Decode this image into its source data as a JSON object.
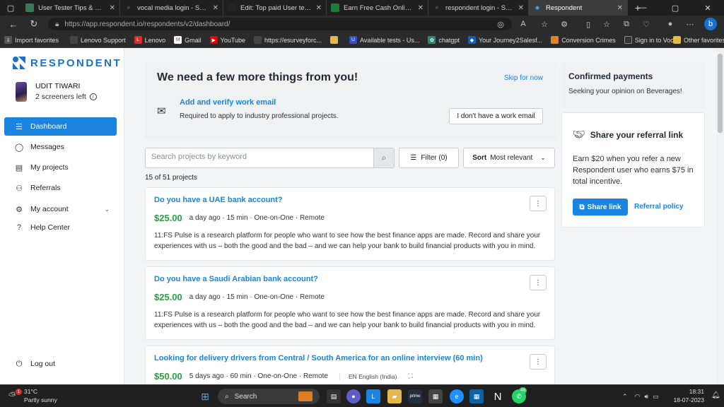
{
  "browser": {
    "tabs": [
      {
        "title": "User Tester Tips & Platform",
        "active": false
      },
      {
        "title": "vocal media login - Search",
        "active": false
      },
      {
        "title": "Edit: Top paid User testing",
        "active": false
      },
      {
        "title": "Earn Free Cash Online | Mak",
        "active": false
      },
      {
        "title": "respondent login - Search",
        "active": false
      },
      {
        "title": "Respondent",
        "active": true
      }
    ],
    "url": "https://app.respondent.io/respondents/v2/dashboard/",
    "bookmarks": [
      "Import favorites",
      "Lenovo Support",
      "Lenovo",
      "Gmail",
      "YouTube",
      "https://esurveyforc...",
      "Available tests - Us...",
      "chatgpt",
      "Your Journey2Salesf...",
      "Conversion Crimes",
      "Sign in to Vocal",
      "Other favorites"
    ]
  },
  "sidebar": {
    "logo": "RESPONDENT",
    "user_name": "UDIT TIWARI",
    "screeners_left": "2 screeners left",
    "nav": [
      {
        "label": "Dashboard",
        "icon": "dashboard-icon",
        "active": true
      },
      {
        "label": "Messages",
        "icon": "chat-icon",
        "active": false
      },
      {
        "label": "My projects",
        "icon": "projects-icon",
        "active": false
      },
      {
        "label": "Referrals",
        "icon": "referrals-icon",
        "active": false
      },
      {
        "label": "My account",
        "icon": "account-icon",
        "active": false
      },
      {
        "label": "Help Center",
        "icon": "help-icon",
        "active": false
      }
    ],
    "logout": "Log out"
  },
  "onboarding": {
    "heading": "We need a few more things from you!",
    "skip": "Skip for now",
    "item_title": "Add and verify work email",
    "item_sub": "Required to apply to industry professional projects.",
    "no_work_email": "I don't have a work email"
  },
  "search": {
    "placeholder": "Search projects by keyword",
    "filter_label": "Filter (0)",
    "sort_label": "Sort",
    "sort_value": "Most relevant"
  },
  "result_count": "15 of 51 projects",
  "projects": [
    {
      "title": "Do you have a UAE bank account?",
      "price": "$25.00",
      "meta": "a day ago · 15 min · One-on-One · Remote",
      "desc": "11:FS Pulse is a research platform for people who want to see how the best finance apps are made. Record and share your experiences with us – both the good and the bad – and we can help your bank to build financial products with you in mind."
    },
    {
      "title": "Do you have a Saudi Arabian bank account?",
      "price": "$25.00",
      "meta": "a day ago · 15 min · One-on-One · Remote",
      "desc": "11:FS Pulse is a research platform for people who want to see how the best finance apps are made. Record and share your experiences with us – both the good and the bad – and we can help your bank to build financial products with you in mind."
    },
    {
      "title": "Looking for delivery drivers from Central / South America for an online interview (60 min)",
      "price": "$50.00",
      "meta": "5 days ago · 60 min · One-on-One · Remote",
      "lang": "EN English (India)"
    }
  ],
  "right": {
    "confirmed_title": "Confirmed payments",
    "confirmed_sub": "Seeking your opinion on Beverages!",
    "referral_title": "Share your referral link",
    "referral_text": "Earn $20 when you refer a new Respondent user who earns $75 in total incentive.",
    "share_label": "Share link",
    "policy_label": "Referral policy"
  },
  "taskbar": {
    "temp": "31°C",
    "weather": "Partly sunny",
    "search": "Search",
    "time": "18:31",
    "date": "18-07-2023",
    "notif_badge": "46",
    "weather_badge": "1"
  },
  "colors": {
    "accent": "#1a84e0",
    "price": "#2e9e3e"
  }
}
